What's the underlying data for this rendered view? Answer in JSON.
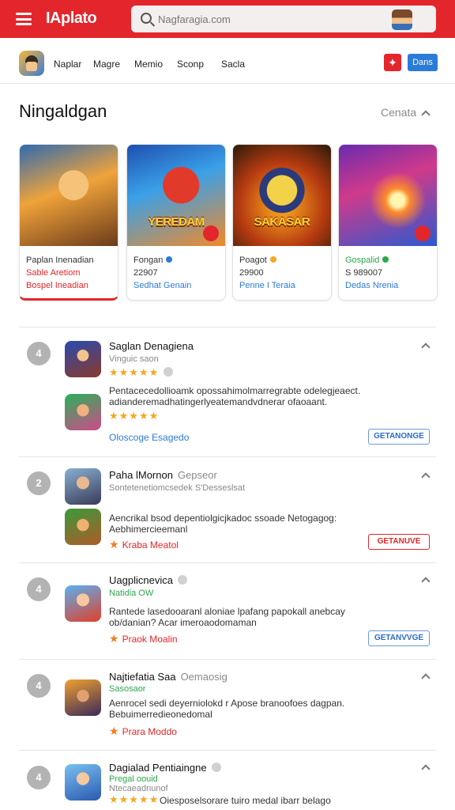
{
  "topbar": {
    "logo": "IAplato",
    "search_placeholder": "Nagfaragia.com"
  },
  "nav": {
    "links": [
      "Naplar",
      "Magre",
      "Memio",
      "Sconp",
      "Sacla"
    ],
    "red_button_icon": "star-icon",
    "blue_button_label": "Dans"
  },
  "section": {
    "title": "Ningaldgan",
    "more_label": "Cenata"
  },
  "cards": [
    {
      "banner": "",
      "line1": "Paplan Inenadian",
      "line2": "Sable Aretiom",
      "line3": "Bospel Ineadian"
    },
    {
      "banner": "YEREDAM",
      "line1": "Fongan",
      "line2": "22907",
      "line3": "Sedhat Genain"
    },
    {
      "banner": "SAKASAR",
      "line1": "Poagot",
      "line2": "29900",
      "line3": "Penne I Teraia"
    },
    {
      "banner": "",
      "line1": "Gospalid",
      "line2": "S 989007",
      "line3": "Dedas Nrenia"
    }
  ],
  "list": [
    {
      "rank": "4",
      "title": "Saglan Denagiena",
      "subtitle": "Vinguic saon",
      "stars": "★★★★★",
      "stars2": "★★★★★",
      "description": "Pentacecedollioamk opossahimolmarregrabte odelegjeaect. adianderemadhatingerlyeatemandvdnerar ofaoaant.",
      "link": "Oloscoge Esagedo",
      "cta": "GETANONGE"
    },
    {
      "rank": "2",
      "title": "Paha lMornon",
      "title_muted": "Gepseor",
      "subtitle": "Sontetenetiomcsedek S'Desseslsat",
      "description": "Aencrikal bsod depentiolgicjkadoc ssoade Netogagog: Aebhimercieemanl",
      "link": "Kraba Meatol",
      "cta": "GETANUVE"
    },
    {
      "rank": "4",
      "title": "Uagplicnevica",
      "subtitle": "Natidia OW",
      "description": "Rantede lasedooaranl aloniae lpafang papokall anebcay ob/danian? Acar imeroaodomaman",
      "link": "Praok Moalin",
      "cta": "GETANVVGE"
    },
    {
      "rank": "4",
      "title": "Najtiefatia Saa",
      "title_muted": "Oemaosig",
      "subtitle": "Sasosaor",
      "description": "Aenrocel sedi deyerniolokd r Apose branoofoes dagpan. Bebuimerredieonedomal",
      "link": "Prara Moddo",
      "cta": ""
    },
    {
      "rank": "4",
      "title": "Dagialad Pentiaingne",
      "subtitle": "Pregal oouid",
      "subtitle2": "Ntecaeadnunof",
      "stars": "★★★★★",
      "description": "Oiesposelsorare tuiro medal ibarr belago",
      "link": "",
      "cta": ""
    }
  ]
}
